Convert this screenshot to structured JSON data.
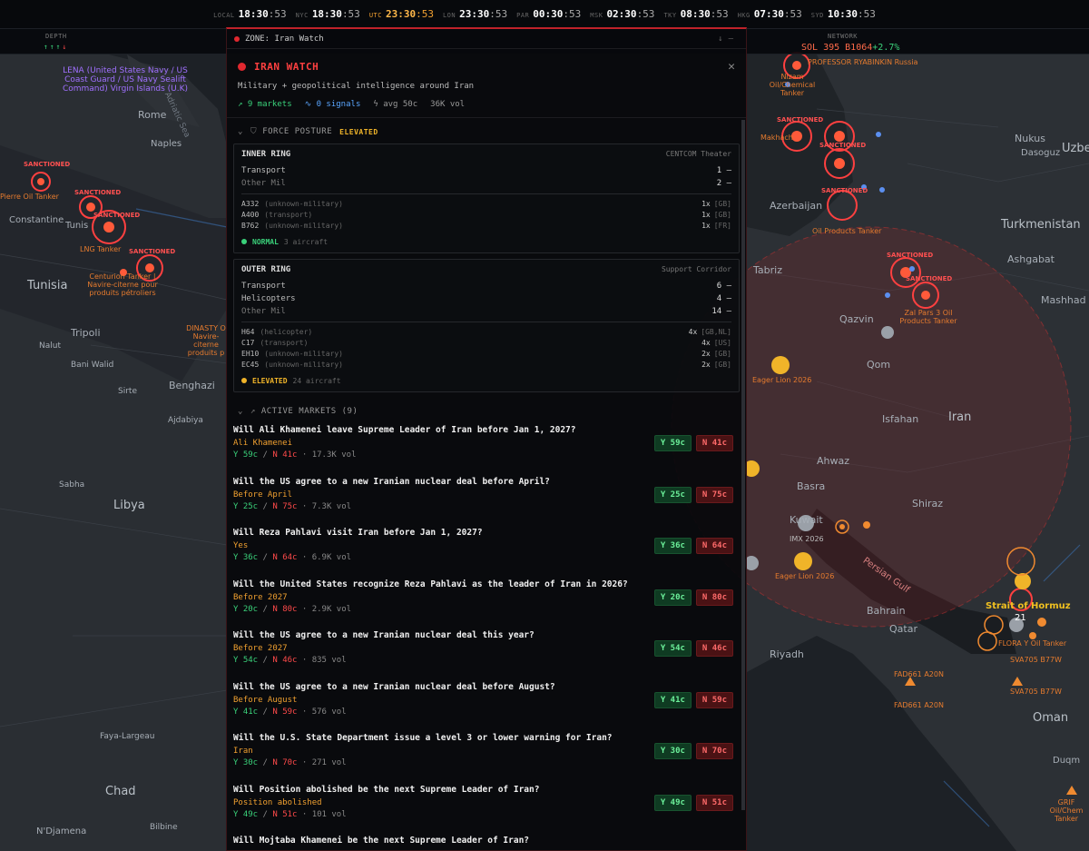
{
  "clocks": [
    {
      "label": "LOCAL",
      "hm": "18:30",
      "s": ":53"
    },
    {
      "label": "NYC",
      "hm": "18:30",
      "s": ":53"
    },
    {
      "label": "UTC",
      "hm": "23:30",
      "s": ":53"
    },
    {
      "label": "LON",
      "hm": "23:30",
      "s": ":53"
    },
    {
      "label": "PAR",
      "hm": "00:30",
      "s": ":53"
    },
    {
      "label": "MSK",
      "hm": "02:30",
      "s": ":53"
    },
    {
      "label": "TKY",
      "hm": "08:30",
      "s": ":53"
    },
    {
      "label": "HKG",
      "hm": "07:30",
      "s": ":53"
    },
    {
      "label": "SYD",
      "hm": "10:30",
      "s": ":53"
    }
  ],
  "status": {
    "depth_label": "DEPTH",
    "network_label": "NETWORK",
    "ticker_sol": "SOL 395 B1064",
    "ticker_change": "+2.7%"
  },
  "panel": {
    "header": "ZONE: Iran Watch",
    "title": "IRAN WATCH",
    "subtitle": "Military + geopolitical intelligence around Iran",
    "stats": {
      "markets": "9 markets",
      "signals": "0 signals",
      "avg": "avg 50c",
      "vol": "36K vol"
    },
    "force_posture": {
      "label": "FORCE POSTURE",
      "status": "ELEVATED",
      "inner": {
        "title": "INNER RING",
        "theater": "CENTCOM Theater",
        "rows": [
          {
            "label": "Transport",
            "value": "1 —"
          },
          {
            "label": "Other Mil",
            "value": "2 —"
          }
        ],
        "aircraft": [
          {
            "code": "A332",
            "type": "(unknown-military)",
            "count": "1x",
            "flag": "[GB]"
          },
          {
            "code": "A400",
            "type": "(transport)",
            "count": "1x",
            "flag": "[GB]"
          },
          {
            "code": "B762",
            "type": "(unknown-military)",
            "count": "1x",
            "flag": "[FR]"
          }
        ],
        "level": "NORMAL",
        "count": "3 aircraft"
      },
      "outer": {
        "title": "OUTER RING",
        "theater": "Support Corridor",
        "rows": [
          {
            "label": "Transport",
            "value": "6 —"
          },
          {
            "label": "Helicopters",
            "value": "4 —"
          },
          {
            "label": "Other Mil",
            "value": "14 —"
          }
        ],
        "aircraft": [
          {
            "code": "H64",
            "type": "(helicopter)",
            "count": "4x",
            "flag": "[GB,NL]"
          },
          {
            "code": "C17",
            "type": "(transport)",
            "count": "4x",
            "flag": "[US]"
          },
          {
            "code": "EH10",
            "type": "(unknown-military)",
            "count": "2x",
            "flag": "[GB]"
          },
          {
            "code": "EC45",
            "type": "(unknown-military)",
            "count": "2x",
            "flag": "[GB]"
          }
        ],
        "level": "ELEVATED",
        "count": "24 aircraft"
      }
    },
    "markets_label": "ACTIVE MARKETS (9)",
    "markets": [
      {
        "q": "Will Ali Khamenei leave Supreme Leader of Iran before Jan 1, 2027?",
        "outcome": "Ali Khamenei",
        "y": "Y 59c",
        "n": "N 41c",
        "vol": "17.3K vol"
      },
      {
        "q": "Will the US agree to a new Iranian nuclear deal before April?",
        "outcome": "Before April",
        "y": "Y 25c",
        "n": "N 75c",
        "vol": "7.3K vol"
      },
      {
        "q": "Will Reza Pahlavi visit Iran before Jan 1, 2027?",
        "outcome": "Yes",
        "y": "Y 36c",
        "n": "N 64c",
        "vol": "6.9K vol"
      },
      {
        "q": "Will the United States recognize Reza Pahlavi as the leader of Iran in 2026?",
        "outcome": "Before 2027",
        "y": "Y 20c",
        "n": "N 80c",
        "vol": "2.9K vol"
      },
      {
        "q": "Will the US agree to a new Iranian nuclear deal this year?",
        "outcome": "Before 2027",
        "y": "Y 54c",
        "n": "N 46c",
        "vol": "835 vol"
      },
      {
        "q": "Will the US agree to a new Iranian nuclear deal before August?",
        "outcome": "Before August",
        "y": "Y 41c",
        "n": "N 59c",
        "vol": "576 vol"
      },
      {
        "q": "Will the U.S. State Department issue a level 3 or lower warning for Iran?",
        "outcome": "Iran",
        "y": "Y 30c",
        "n": "N 70c",
        "vol": "271 vol"
      },
      {
        "q": "Will Position abolished be the next Supreme Leader of Iran?",
        "outcome": "Position abolished",
        "y": "Y 49c",
        "n": "N 51c",
        "vol": "101 vol"
      },
      {
        "q": "Will Mojtaba Khamenei be the next Supreme Leader of Iran?",
        "outcome": "",
        "y": "",
        "n": "",
        "vol": ""
      }
    ]
  },
  "map": {
    "places": [
      "Rome",
      "Naples",
      "Constantine",
      "Tunis",
      "Tunisia",
      "Tripoli",
      "Nalut",
      "Bani Walid",
      "Sirte",
      "Benghazi",
      "Ajdabiya",
      "Sabha",
      "Libya",
      "Faya-Largeau",
      "Chad",
      "Bilbine",
      "N'Djamena",
      "Nukus",
      "Dasoguz",
      "Uzbe",
      "Turkmenistan",
      "Ashgabat",
      "Mashhad",
      "Azerbaijan",
      "Tabriz",
      "Qazvin",
      "Qom",
      "Isfahan",
      "Iran",
      "Ahwaz",
      "Basra",
      "Kuwait",
      "Shiraz",
      "Bahrain",
      "Qatar",
      "Riyadh",
      "Oman",
      "Duqm",
      "Adriatic Sea",
      "Persian Gulf"
    ],
    "vessels": [
      "LENA (United States Navy / US Coast Guard / US Navy Sealift Command) Virgin Islands (U.K)",
      "Pierre Oil Tanker",
      "LNG Tanker",
      "Centurion Tanker | Navire-citerne pour produits pétroliers",
      "DINASTY O Navire-citerne produits p",
      "PROFESSOR RYABINKIN Russia",
      "Nizam Oil/Chemical Tanker",
      "Makhach",
      "Oil Products Tanker",
      "Zal Pars 3 Oil Products Tanker",
      "Eager Lion 2026",
      "IMX 2026",
      "Strait of Hormuz",
      "21",
      "FLORA Y Oil Tanker",
      "SVA705 B77W",
      "FAD661 A20N",
      "GRIF Oil/Chem Tanker",
      "SANCTIONED"
    ]
  }
}
